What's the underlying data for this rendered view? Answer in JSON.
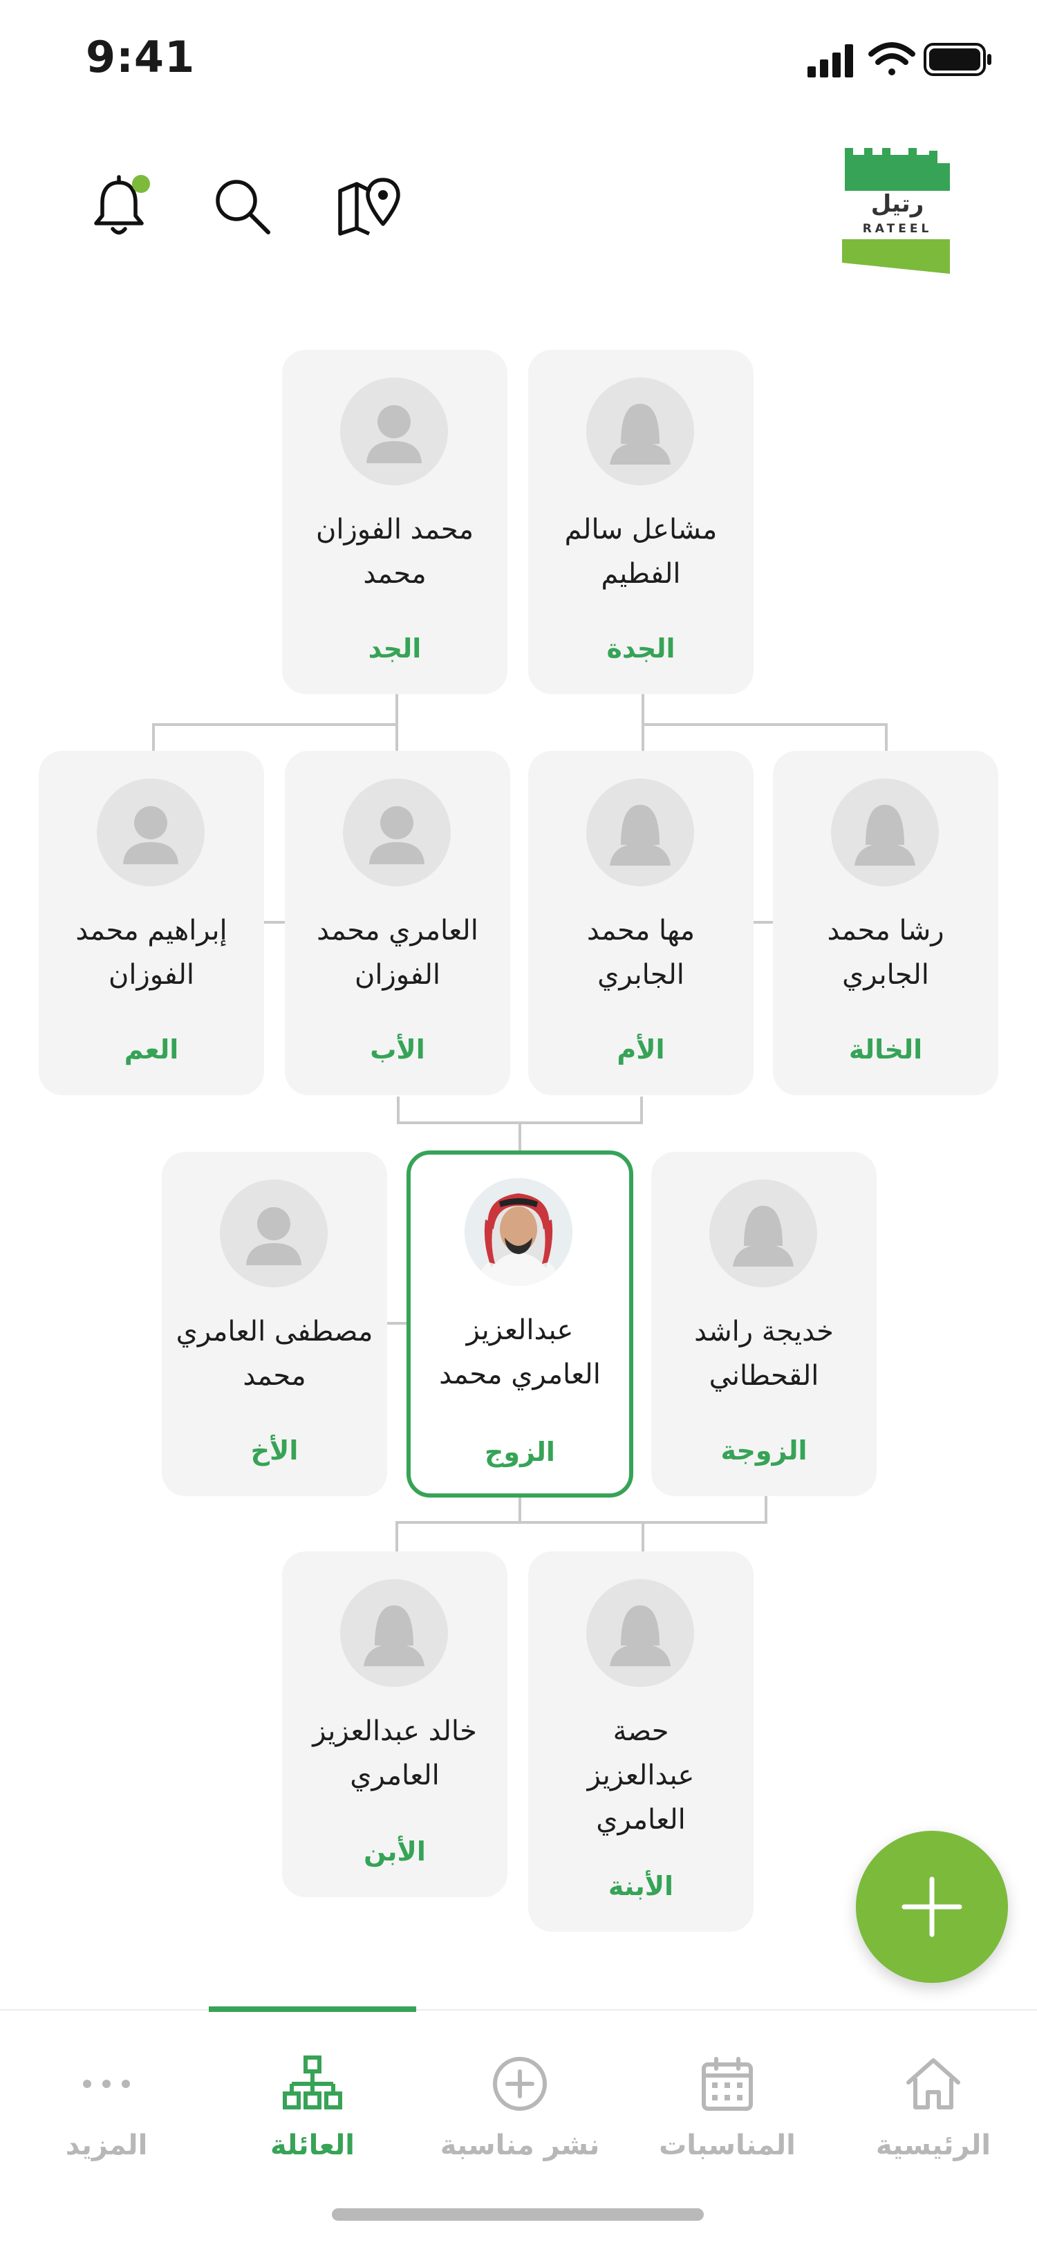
{
  "status_bar": {
    "time": "9:41"
  },
  "header": {
    "logo_text_ar": "رتيل",
    "logo_text_en": "RATEEL",
    "icons": [
      "bell-icon",
      "search-icon",
      "map-pin-icon"
    ],
    "notification_dot_color": "#7cba3c"
  },
  "tree": {
    "grandmother": {
      "name": "مشاعل سالم الفطيم",
      "role": "الجدة",
      "avatar": "female"
    },
    "grandfather": {
      "name": "محمد الفوزان محمد",
      "role": "الجد",
      "avatar": "male"
    },
    "aunt": {
      "name": "رشا محمد الجابري",
      "role": "الخالة",
      "avatar": "female"
    },
    "mother": {
      "name": "مها محمد الجابري",
      "role": "الأم",
      "avatar": "female"
    },
    "father": {
      "name": "العامري محمد الفوزان",
      "role": "الأب",
      "avatar": "male"
    },
    "uncle": {
      "name": "إبراهيم محمد الفوزان",
      "role": "العم",
      "avatar": "male"
    },
    "wife": {
      "name": "خديجة راشد القحطاني",
      "role": "الزوجة",
      "avatar": "female"
    },
    "self": {
      "name": "عبدالعزيز العامري محمد",
      "role": "الزوج",
      "avatar": "photo",
      "selected": true
    },
    "brother": {
      "name": "مصطفى العامري محمد",
      "role": "الأخ",
      "avatar": "male"
    },
    "daughter": {
      "name": "حصة عبدالعزيز العامري",
      "role": "الأبنة",
      "avatar": "female"
    },
    "son": {
      "name": "خالد عبدالعزيز العامري",
      "role": "الأبن",
      "avatar": "female"
    }
  },
  "colors": {
    "accent": "#36a356",
    "fab": "#7cba3c",
    "card_bg": "#f4f4f4",
    "inactive": "#b7b7b7"
  },
  "tabbar": {
    "tabs": [
      {
        "label": "الرئيسية",
        "icon": "home-icon"
      },
      {
        "label": "المناسبات",
        "icon": "calendar-icon"
      },
      {
        "label": "نشر مناسبة",
        "icon": "plus-circle-icon"
      },
      {
        "label": "العائلة",
        "icon": "family-tree-icon",
        "active": true
      },
      {
        "label": "المزيد",
        "icon": "more-dots-icon"
      }
    ]
  }
}
